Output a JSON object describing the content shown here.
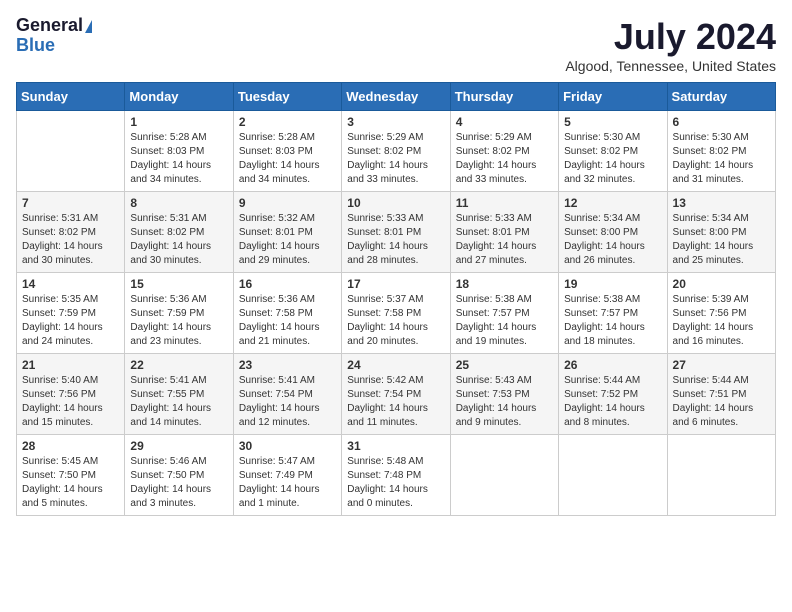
{
  "header": {
    "logo_general": "General",
    "logo_blue": "Blue",
    "month_year": "July 2024",
    "location": "Algood, Tennessee, United States"
  },
  "days_of_week": [
    "Sunday",
    "Monday",
    "Tuesday",
    "Wednesday",
    "Thursday",
    "Friday",
    "Saturday"
  ],
  "weeks": [
    [
      {
        "day": "",
        "sunrise": "",
        "sunset": "",
        "daylight": ""
      },
      {
        "day": "1",
        "sunrise": "Sunrise: 5:28 AM",
        "sunset": "Sunset: 8:03 PM",
        "daylight": "Daylight: 14 hours and 34 minutes."
      },
      {
        "day": "2",
        "sunrise": "Sunrise: 5:28 AM",
        "sunset": "Sunset: 8:03 PM",
        "daylight": "Daylight: 14 hours and 34 minutes."
      },
      {
        "day": "3",
        "sunrise": "Sunrise: 5:29 AM",
        "sunset": "Sunset: 8:02 PM",
        "daylight": "Daylight: 14 hours and 33 minutes."
      },
      {
        "day": "4",
        "sunrise": "Sunrise: 5:29 AM",
        "sunset": "Sunset: 8:02 PM",
        "daylight": "Daylight: 14 hours and 33 minutes."
      },
      {
        "day": "5",
        "sunrise": "Sunrise: 5:30 AM",
        "sunset": "Sunset: 8:02 PM",
        "daylight": "Daylight: 14 hours and 32 minutes."
      },
      {
        "day": "6",
        "sunrise": "Sunrise: 5:30 AM",
        "sunset": "Sunset: 8:02 PM",
        "daylight": "Daylight: 14 hours and 31 minutes."
      }
    ],
    [
      {
        "day": "7",
        "sunrise": "Sunrise: 5:31 AM",
        "sunset": "Sunset: 8:02 PM",
        "daylight": "Daylight: 14 hours and 30 minutes."
      },
      {
        "day": "8",
        "sunrise": "Sunrise: 5:31 AM",
        "sunset": "Sunset: 8:02 PM",
        "daylight": "Daylight: 14 hours and 30 minutes."
      },
      {
        "day": "9",
        "sunrise": "Sunrise: 5:32 AM",
        "sunset": "Sunset: 8:01 PM",
        "daylight": "Daylight: 14 hours and 29 minutes."
      },
      {
        "day": "10",
        "sunrise": "Sunrise: 5:33 AM",
        "sunset": "Sunset: 8:01 PM",
        "daylight": "Daylight: 14 hours and 28 minutes."
      },
      {
        "day": "11",
        "sunrise": "Sunrise: 5:33 AM",
        "sunset": "Sunset: 8:01 PM",
        "daylight": "Daylight: 14 hours and 27 minutes."
      },
      {
        "day": "12",
        "sunrise": "Sunrise: 5:34 AM",
        "sunset": "Sunset: 8:00 PM",
        "daylight": "Daylight: 14 hours and 26 minutes."
      },
      {
        "day": "13",
        "sunrise": "Sunrise: 5:34 AM",
        "sunset": "Sunset: 8:00 PM",
        "daylight": "Daylight: 14 hours and 25 minutes."
      }
    ],
    [
      {
        "day": "14",
        "sunrise": "Sunrise: 5:35 AM",
        "sunset": "Sunset: 7:59 PM",
        "daylight": "Daylight: 14 hours and 24 minutes."
      },
      {
        "day": "15",
        "sunrise": "Sunrise: 5:36 AM",
        "sunset": "Sunset: 7:59 PM",
        "daylight": "Daylight: 14 hours and 23 minutes."
      },
      {
        "day": "16",
        "sunrise": "Sunrise: 5:36 AM",
        "sunset": "Sunset: 7:58 PM",
        "daylight": "Daylight: 14 hours and 21 minutes."
      },
      {
        "day": "17",
        "sunrise": "Sunrise: 5:37 AM",
        "sunset": "Sunset: 7:58 PM",
        "daylight": "Daylight: 14 hours and 20 minutes."
      },
      {
        "day": "18",
        "sunrise": "Sunrise: 5:38 AM",
        "sunset": "Sunset: 7:57 PM",
        "daylight": "Daylight: 14 hours and 19 minutes."
      },
      {
        "day": "19",
        "sunrise": "Sunrise: 5:38 AM",
        "sunset": "Sunset: 7:57 PM",
        "daylight": "Daylight: 14 hours and 18 minutes."
      },
      {
        "day": "20",
        "sunrise": "Sunrise: 5:39 AM",
        "sunset": "Sunset: 7:56 PM",
        "daylight": "Daylight: 14 hours and 16 minutes."
      }
    ],
    [
      {
        "day": "21",
        "sunrise": "Sunrise: 5:40 AM",
        "sunset": "Sunset: 7:56 PM",
        "daylight": "Daylight: 14 hours and 15 minutes."
      },
      {
        "day": "22",
        "sunrise": "Sunrise: 5:41 AM",
        "sunset": "Sunset: 7:55 PM",
        "daylight": "Daylight: 14 hours and 14 minutes."
      },
      {
        "day": "23",
        "sunrise": "Sunrise: 5:41 AM",
        "sunset": "Sunset: 7:54 PM",
        "daylight": "Daylight: 14 hours and 12 minutes."
      },
      {
        "day": "24",
        "sunrise": "Sunrise: 5:42 AM",
        "sunset": "Sunset: 7:54 PM",
        "daylight": "Daylight: 14 hours and 11 minutes."
      },
      {
        "day": "25",
        "sunrise": "Sunrise: 5:43 AM",
        "sunset": "Sunset: 7:53 PM",
        "daylight": "Daylight: 14 hours and 9 minutes."
      },
      {
        "day": "26",
        "sunrise": "Sunrise: 5:44 AM",
        "sunset": "Sunset: 7:52 PM",
        "daylight": "Daylight: 14 hours and 8 minutes."
      },
      {
        "day": "27",
        "sunrise": "Sunrise: 5:44 AM",
        "sunset": "Sunset: 7:51 PM",
        "daylight": "Daylight: 14 hours and 6 minutes."
      }
    ],
    [
      {
        "day": "28",
        "sunrise": "Sunrise: 5:45 AM",
        "sunset": "Sunset: 7:50 PM",
        "daylight": "Daylight: 14 hours and 5 minutes."
      },
      {
        "day": "29",
        "sunrise": "Sunrise: 5:46 AM",
        "sunset": "Sunset: 7:50 PM",
        "daylight": "Daylight: 14 hours and 3 minutes."
      },
      {
        "day": "30",
        "sunrise": "Sunrise: 5:47 AM",
        "sunset": "Sunset: 7:49 PM",
        "daylight": "Daylight: 14 hours and 1 minute."
      },
      {
        "day": "31",
        "sunrise": "Sunrise: 5:48 AM",
        "sunset": "Sunset: 7:48 PM",
        "daylight": "Daylight: 14 hours and 0 minutes."
      },
      {
        "day": "",
        "sunrise": "",
        "sunset": "",
        "daylight": ""
      },
      {
        "day": "",
        "sunrise": "",
        "sunset": "",
        "daylight": ""
      },
      {
        "day": "",
        "sunrise": "",
        "sunset": "",
        "daylight": ""
      }
    ]
  ]
}
